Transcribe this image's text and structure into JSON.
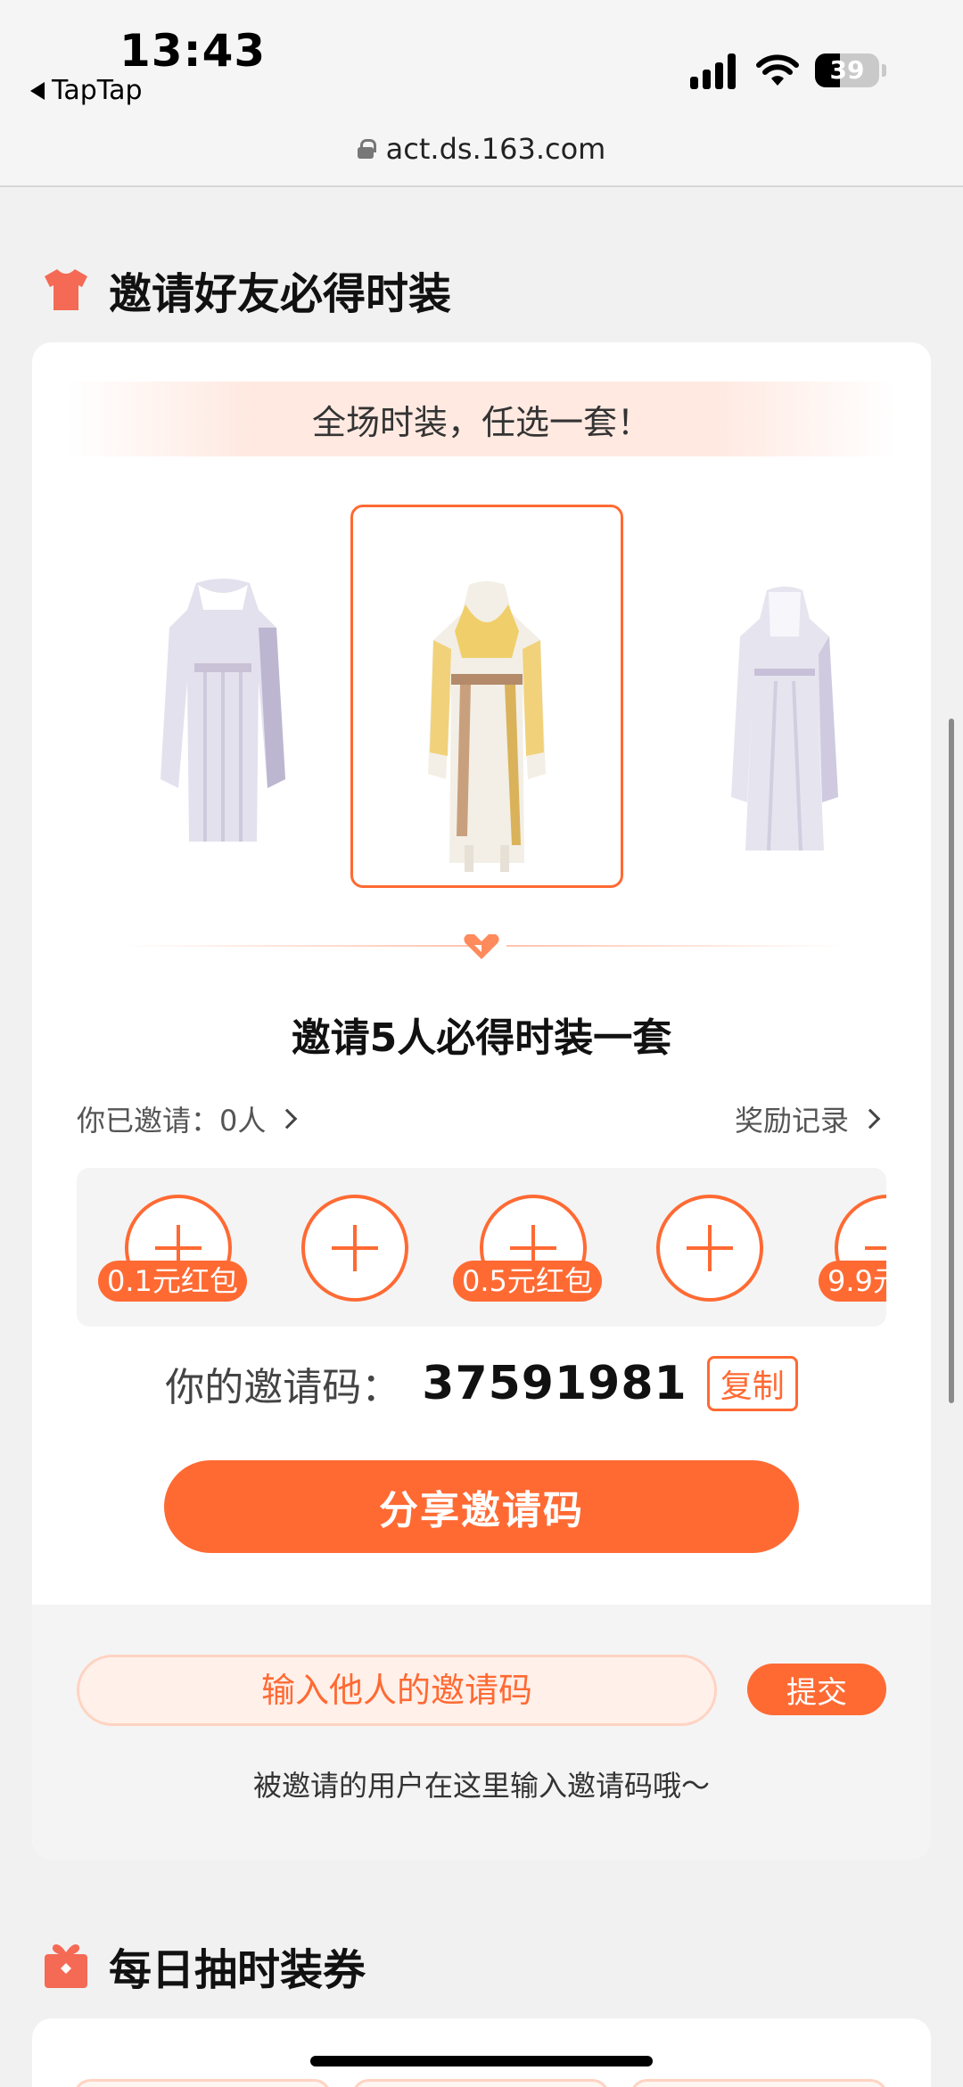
{
  "status_bar": {
    "time": "13:43",
    "back_app": "TapTap",
    "battery": "39"
  },
  "browser": {
    "url": "act.ds.163.com"
  },
  "invite_section": {
    "title": "邀请好友必得时装",
    "banner": "全场时装，任选一套！",
    "costumes": [
      "costume-left",
      "costume-center-selected",
      "costume-right"
    ],
    "invite_title": "邀请5人必得时装一套",
    "invited_label": "你已邀请：0人",
    "reward_log": "奖励记录",
    "slots": [
      {
        "reward": "0.1元红包"
      },
      {
        "reward": ""
      },
      {
        "reward": "0.5元红包"
      },
      {
        "reward": ""
      },
      {
        "reward": "9.9元"
      }
    ],
    "code_label": "你的邀请码：",
    "code_value": "37591981",
    "copy_label": "复制",
    "share_label": "分享邀请码",
    "input_placeholder": "输入他人的邀请码",
    "submit_label": "提交",
    "hint": "被邀请的用户在这里输入邀请码哦～"
  },
  "daily_section": {
    "title": "每日抽时装券"
  },
  "colors": {
    "accent": "#ff6a33",
    "accent_light": "#ffe9e1"
  }
}
